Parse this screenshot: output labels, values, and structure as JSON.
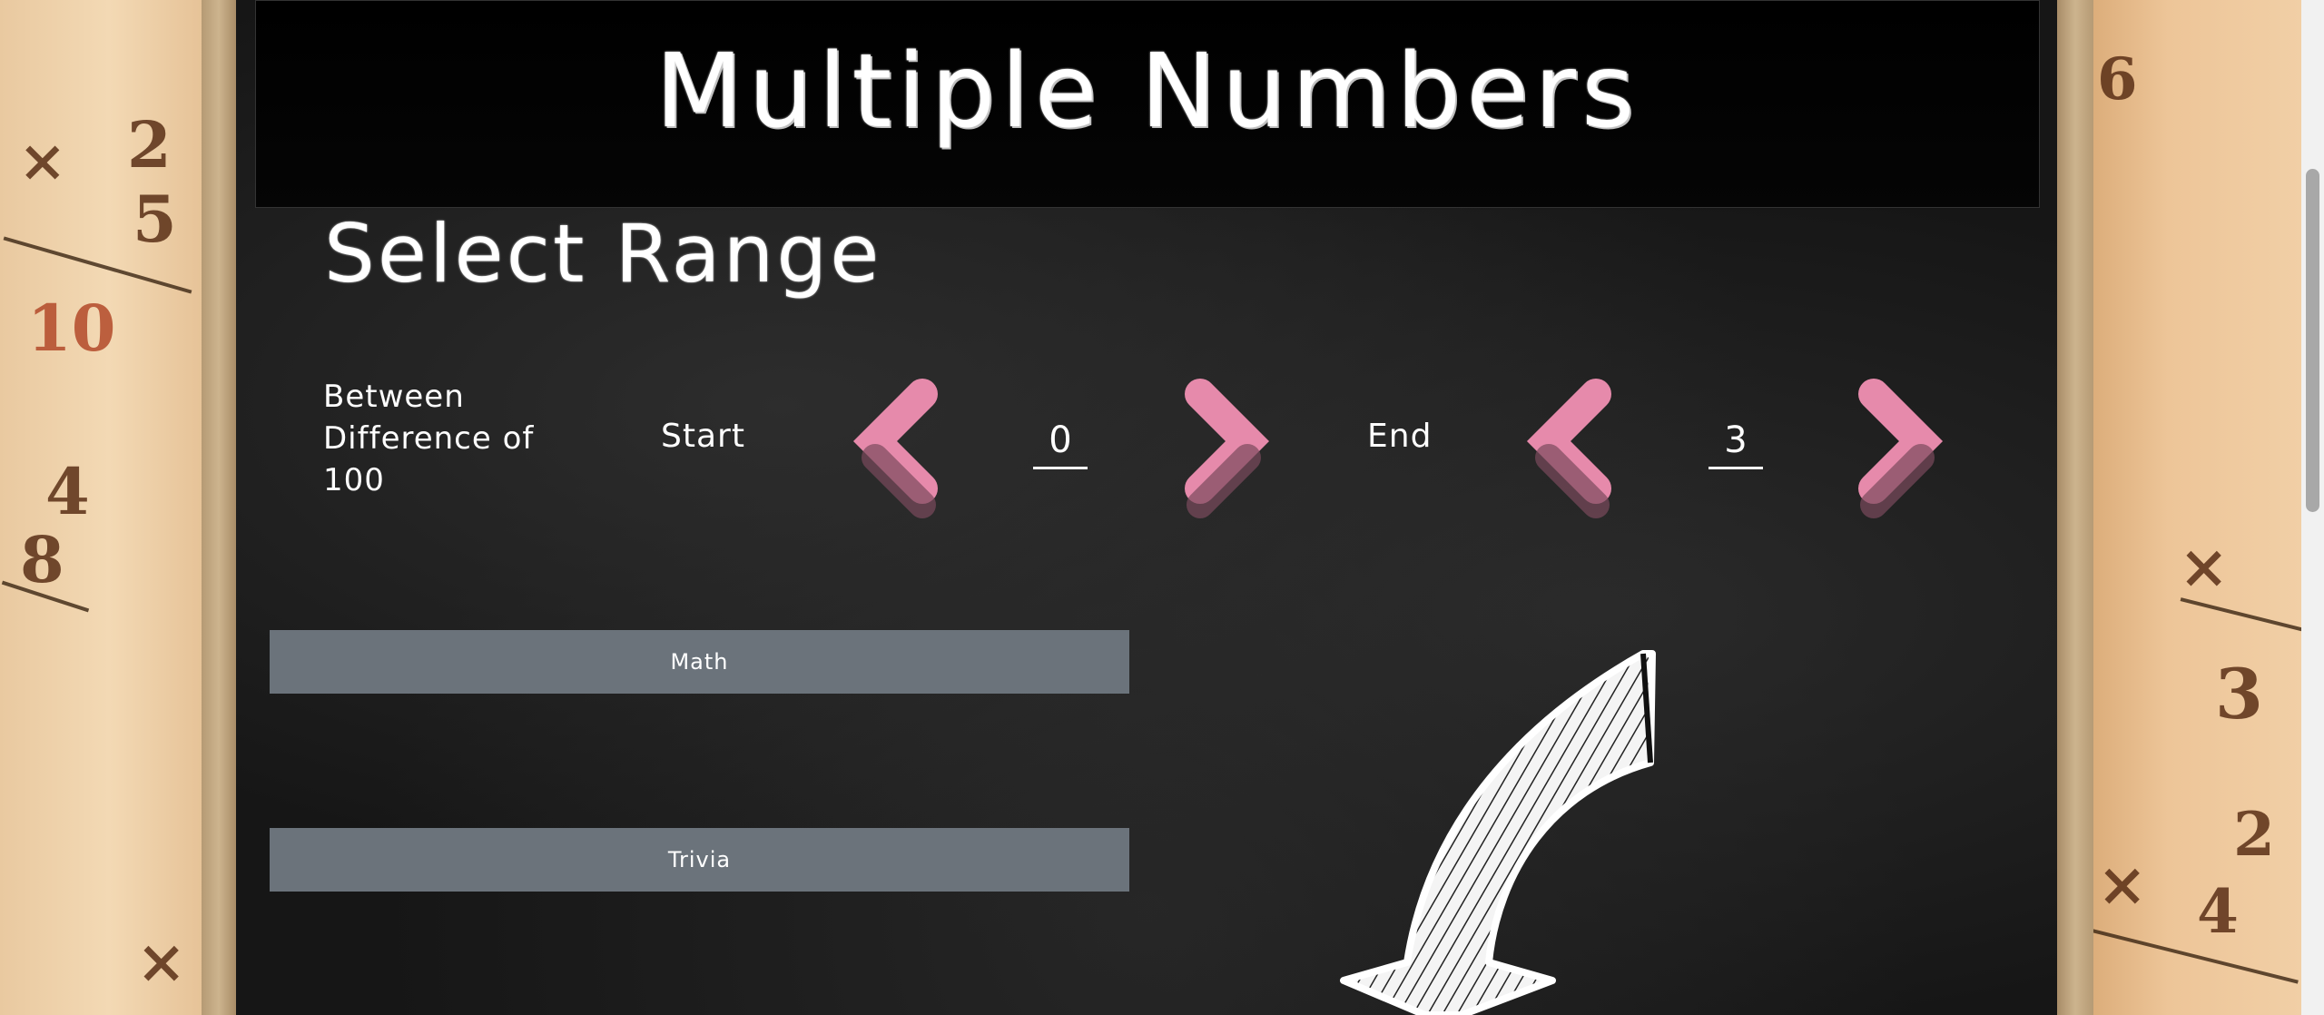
{
  "header": {
    "title": "Multiple Numbers"
  },
  "range": {
    "section_title": "Select Range",
    "description": "Between Difference of 100",
    "start": {
      "label": "Start",
      "value": "0"
    },
    "end": {
      "label": "End",
      "value": "3"
    }
  },
  "buttons": {
    "math": "Math",
    "trivia": "Trivia"
  },
  "colors": {
    "chevron": "#e68aab",
    "button": "#6b737b",
    "board": "#161616"
  }
}
